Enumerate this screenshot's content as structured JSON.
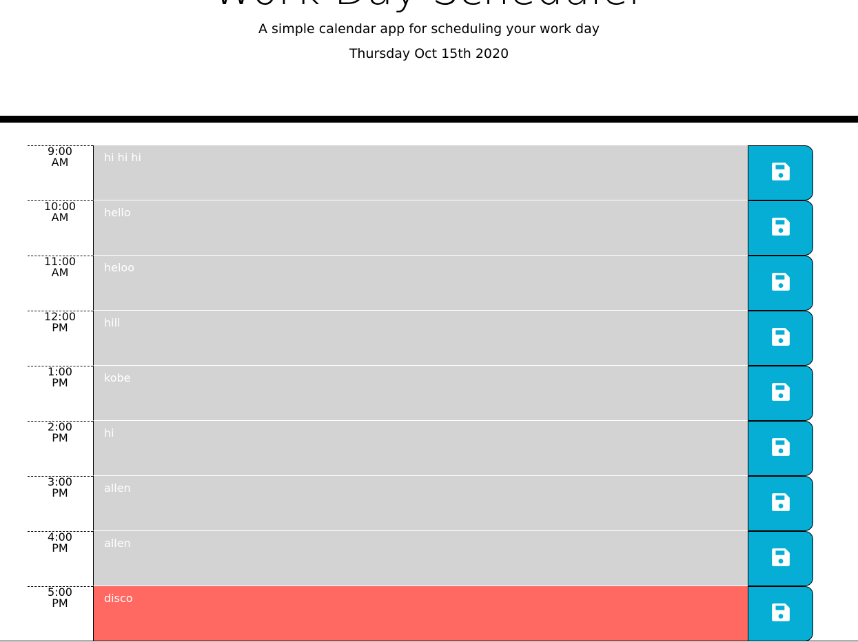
{
  "header": {
    "title": "Work Day Scheduler",
    "subtitle": "A simple calendar app for scheduling your work day",
    "current_day": "Thursday Oct 15th 2020"
  },
  "colors": {
    "past": "#d3d3d3",
    "present": "#ff6961",
    "save_button": "#06aed5"
  },
  "save_icon": "floppy-disk-icon",
  "time_blocks": [
    {
      "hour": "9:00 AM",
      "text": "hi hi hi",
      "state": "past"
    },
    {
      "hour": "10:00 AM",
      "text": "hello",
      "state": "past"
    },
    {
      "hour": "11:00 AM",
      "text": "heloo",
      "state": "past"
    },
    {
      "hour": "12:00 PM",
      "text": "hill",
      "state": "past"
    },
    {
      "hour": "1:00 PM",
      "text": "kobe",
      "state": "past"
    },
    {
      "hour": "2:00 PM",
      "text": "hi",
      "state": "past"
    },
    {
      "hour": "3:00 PM",
      "text": "allen",
      "state": "past"
    },
    {
      "hour": "4:00 PM",
      "text": "allen",
      "state": "past"
    },
    {
      "hour": "5:00 PM",
      "text": "disco",
      "state": "present"
    }
  ]
}
